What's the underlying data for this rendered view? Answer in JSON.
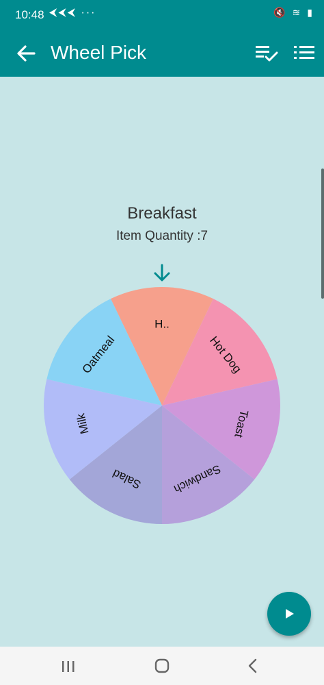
{
  "status_bar": {
    "time": "10:48",
    "left_icons": "⮜⮜⮜  ···",
    "right_icons": "🔇 ≋ ▮"
  },
  "app_bar": {
    "title": "Wheel Pick",
    "icons": [
      "arrow-back-icon",
      "checklist-icon",
      "list-icon"
    ]
  },
  "wheel": {
    "title": "Breakfast",
    "subtitle": "Item Quantity :7",
    "segments": [
      {
        "label": "H..",
        "color": "#f6a08c"
      },
      {
        "label": "Hot Dog",
        "color": "#f493b1"
      },
      {
        "label": "Toast",
        "color": "#cf97da"
      },
      {
        "label": "Sandwich",
        "color": "#b5a0db"
      },
      {
        "label": "Salad",
        "color": "#a3a6d8"
      },
      {
        "label": "Milk",
        "color": "#b1bcf8"
      },
      {
        "label": "Oatmeal",
        "color": "#89d3f5"
      }
    ]
  },
  "fab": {
    "icon": "play-icon",
    "color": "#008b8f"
  },
  "nav_bar": {
    "icons": [
      "recents-icon",
      "home-icon",
      "back-icon"
    ]
  },
  "colors": {
    "primary": "#008b8f",
    "background": "#c7e5e7"
  }
}
